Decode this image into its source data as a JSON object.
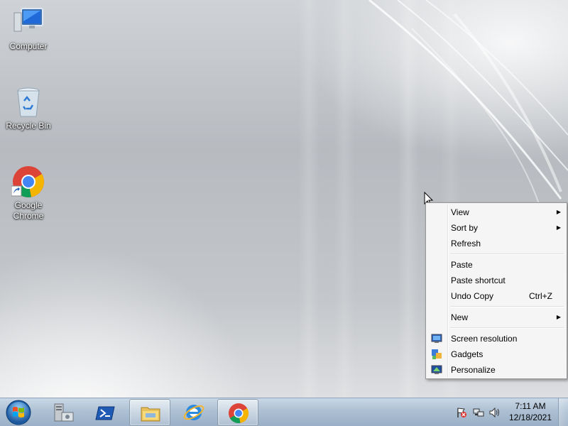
{
  "desktop": {
    "icons": [
      {
        "label": "Computer",
        "icon": "computer-icon"
      },
      {
        "label": "Recycle Bin",
        "icon": "recycle-bin-icon"
      },
      {
        "label": "Google\nChrome",
        "line1": "Google",
        "line2": "Chrome",
        "icon": "chrome-icon"
      }
    ]
  },
  "context_menu": {
    "items": [
      {
        "label": "View",
        "submenu": true
      },
      {
        "label": "Sort by",
        "submenu": true
      },
      {
        "label": "Refresh"
      },
      {
        "label": "Paste"
      },
      {
        "label": "Paste shortcut"
      },
      {
        "label": "Undo Copy",
        "shortcut": "Ctrl+Z"
      },
      {
        "label": "New",
        "submenu": true
      },
      {
        "label": "Screen resolution",
        "icon": "monitor-icon"
      },
      {
        "label": "Gadgets",
        "icon": "gadgets-icon"
      },
      {
        "label": "Personalize",
        "icon": "personalize-icon"
      }
    ],
    "arrow_glyph": "▶"
  },
  "taskbar": {
    "pinned": [
      "server-manager-icon",
      "powershell-icon",
      "file-explorer-icon",
      "internet-explorer-icon",
      "chrome-icon"
    ],
    "clock": {
      "time": "7:11 AM",
      "date": "12/18/2021"
    },
    "tray": [
      "action-center-flag-icon",
      "network-icon",
      "volume-icon"
    ]
  },
  "colors": {
    "menu_bg": "#f5f5f5",
    "taskbar": "#a9bed3",
    "chrome_red": "#db4437",
    "chrome_green": "#0f9d58",
    "chrome_yellow": "#f4b400",
    "chrome_blue": "#4285f4"
  }
}
